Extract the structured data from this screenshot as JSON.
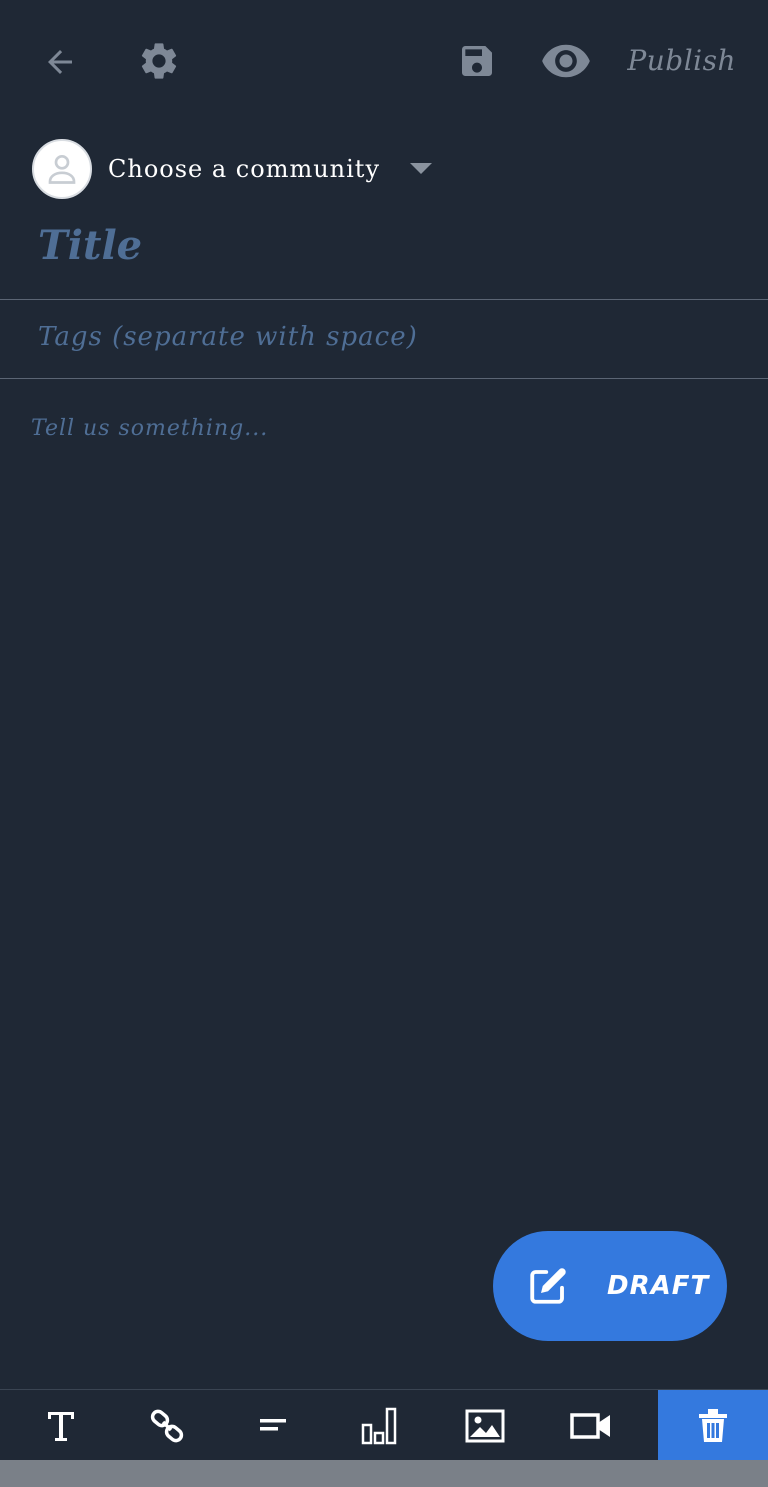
{
  "header": {
    "back_icon": "arrow-left-icon",
    "settings_icon": "gear-icon",
    "save_icon": "floppy-disk-icon",
    "preview_icon": "eye-icon",
    "publish_label": "Publish"
  },
  "community": {
    "avatar_icon": "user-placeholder-icon",
    "label": "Choose a community",
    "dropdown_icon": "caret-down-icon"
  },
  "editor": {
    "title_placeholder": "Title",
    "tags_placeholder": "Tags (separate with space)",
    "body_placeholder": "Tell us something..."
  },
  "fab": {
    "icon": "edit-note-icon",
    "label": "DRAFT"
  },
  "toolbar": {
    "items": [
      {
        "icon": "text-format-icon"
      },
      {
        "icon": "link-icon"
      },
      {
        "icon": "align-text-icon"
      },
      {
        "icon": "poll-chart-icon"
      },
      {
        "icon": "image-icon"
      },
      {
        "icon": "video-camera-icon"
      },
      {
        "icon": "trash-icon"
      }
    ]
  },
  "colors": {
    "background": "#1f2835",
    "accent": "#3479de",
    "placeholder": "#4f6e95",
    "muted_icon": "#7e8896"
  }
}
